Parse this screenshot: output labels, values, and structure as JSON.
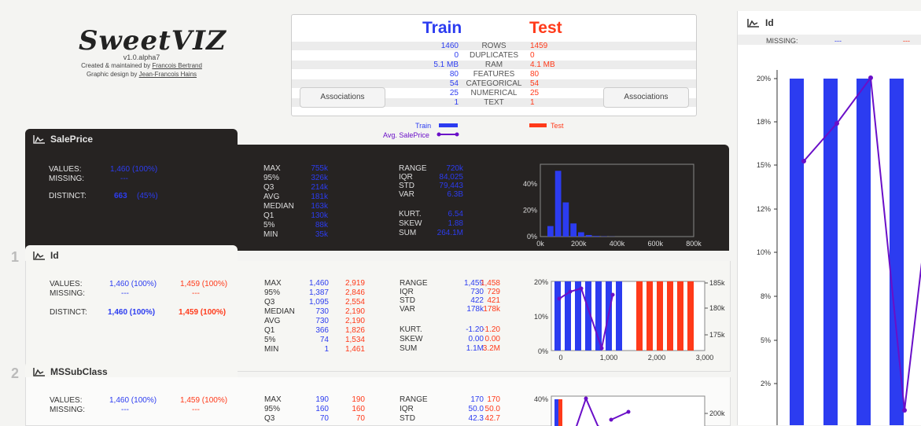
{
  "logo": {
    "word": "SweetVIZ",
    "version": "v1.0.alpha7",
    "line1_prefix": "Created & maintained by ",
    "line1_name": "Francois Bertrand",
    "line2_prefix": "Graphic design by ",
    "line2_name": "Jean-Francois Hains"
  },
  "summary": {
    "train_label": "Train",
    "test_label": "Test",
    "rows": [
      {
        "train": "1460",
        "label": "ROWS",
        "test": "1459"
      },
      {
        "train": "0",
        "label": "DUPLICATES",
        "test": "0"
      },
      {
        "train": "5.1 MB",
        "label": "RAM",
        "test": "4.1 MB"
      },
      {
        "train": "80",
        "label": "FEATURES",
        "test": "80"
      },
      {
        "train": "54",
        "label": "CATEGORICAL",
        "test": "54"
      },
      {
        "train": "25",
        "label": "NUMERICAL",
        "test": "25"
      },
      {
        "train": "1",
        "label": "TEXT",
        "test": "1"
      }
    ],
    "assoc_left": "Associations",
    "assoc_right": "Associations"
  },
  "legend": {
    "train": "Train",
    "avg": "Avg. SalePrice",
    "test": "Test"
  },
  "colors": {
    "train": "#2c3cf0",
    "test": "#ff3a1a",
    "avg": "#6a0fc8"
  },
  "saleprice": {
    "title": "SalePrice",
    "values_label": "VALUES:",
    "values": "1,460",
    "values_pct": "(100%)",
    "missing_label": "MISSING:",
    "missing": "---",
    "distinct_label": "DISTINCT:",
    "distinct": "663",
    "distinct_pct": "(45%)",
    "quantiles": [
      {
        "k": "MAX",
        "v": "755k"
      },
      {
        "k": "95%",
        "v": "326k"
      },
      {
        "k": "Q3",
        "v": "214k"
      },
      {
        "k": "AVG",
        "v": "181k"
      },
      {
        "k": "MEDIAN",
        "v": "163k"
      },
      {
        "k": "Q1",
        "v": "130k"
      },
      {
        "k": "5%",
        "v": "88k"
      },
      {
        "k": "MIN",
        "v": "35k"
      }
    ],
    "stats1": [
      {
        "k": "RANGE",
        "v": "720k"
      },
      {
        "k": "IQR",
        "v": "84,025"
      },
      {
        "k": "STD",
        "v": "79,443"
      },
      {
        "k": "VAR",
        "v": "6.3B"
      }
    ],
    "stats2": [
      {
        "k": "KURT.",
        "v": "6.54"
      },
      {
        "k": "SKEW",
        "v": "1.88"
      },
      {
        "k": "SUM",
        "v": "264.1M"
      }
    ],
    "hist": {
      "yticks": [
        "40%",
        "20%",
        "0%"
      ],
      "xticks": [
        "0k",
        "200k",
        "400k",
        "600k",
        "800k"
      ],
      "bins": [
        0.08,
        0.5,
        0.26,
        0.1,
        0.033,
        0.012,
        0.005,
        0.002,
        0.001
      ]
    }
  },
  "id": {
    "index": "1",
    "title": "Id",
    "values_label": "VALUES:",
    "values": "1,460 (100%)",
    "values_test": "1,459 (100%)",
    "missing_label": "MISSING:",
    "missing": "---",
    "missing_test": "---",
    "distinct_label": "DISTINCT:",
    "distinct": "1,460 (100%)",
    "distinct_test": "1,459 (100%)",
    "quantiles": [
      {
        "k": "MAX",
        "v": "1,460",
        "t": "2,919"
      },
      {
        "k": "95%",
        "v": "1,387",
        "t": "2,846"
      },
      {
        "k": "Q3",
        "v": "1,095",
        "t": "2,554"
      },
      {
        "k": "MEDIAN",
        "v": "730",
        "t": "2,190"
      },
      {
        "k": "AVG",
        "v": "730",
        "t": "2,190"
      },
      {
        "k": "Q1",
        "v": "366",
        "t": "1,826"
      },
      {
        "k": "5%",
        "v": "74",
        "t": "1,534"
      },
      {
        "k": "MIN",
        "v": "1",
        "t": "1,461"
      }
    ],
    "stats1": [
      {
        "k": "RANGE",
        "v": "1,459",
        "t": "1,458"
      },
      {
        "k": "IQR",
        "v": "730",
        "t": "729"
      },
      {
        "k": "STD",
        "v": "422",
        "t": "421"
      },
      {
        "k": "VAR",
        "v": "178k",
        "t": "178k"
      }
    ],
    "stats2": [
      {
        "k": "KURT.",
        "v": "-1.20",
        "t": "-1.20"
      },
      {
        "k": "SKEW",
        "v": "0.00",
        "t": "0.00"
      },
      {
        "k": "SUM",
        "v": "1.1M",
        "t": "3.2M"
      }
    ],
    "hist": {
      "yticks": [
        "20%",
        "10%",
        "0%"
      ],
      "xticks": [
        "0",
        "1,000",
        "2,000",
        "3,000"
      ],
      "y2ticks": [
        "185k",
        "180k",
        "175k"
      ]
    }
  },
  "mssubclass": {
    "index": "2",
    "title": "MSSubClass",
    "values_label": "VALUES:",
    "values": "1,460 (100%)",
    "values_test": "1,459 (100%)",
    "missing_label": "MISSING:",
    "missing": "---",
    "missing_test": "---",
    "quantiles": [
      {
        "k": "MAX",
        "v": "190",
        "t": "190"
      },
      {
        "k": "95%",
        "v": "160",
        "t": "160"
      },
      {
        "k": "Q3",
        "v": "70",
        "t": "70"
      }
    ],
    "stats1": [
      {
        "k": "RANGE",
        "v": "170",
        "t": "170"
      },
      {
        "k": "IQR",
        "v": "50.0",
        "t": "50.0"
      },
      {
        "k": "STD",
        "v": "42.3",
        "t": "42.7"
      }
    ],
    "hist": {
      "ytick": "40%",
      "y2tick": "200k"
    }
  },
  "right": {
    "title": "Id",
    "missing_label": "MISSING:",
    "missing": "---",
    "missing_test": "---",
    "yticks": [
      "20%",
      "18%",
      "15%",
      "12%",
      "10%",
      "8%",
      "5%",
      "2%"
    ]
  }
}
